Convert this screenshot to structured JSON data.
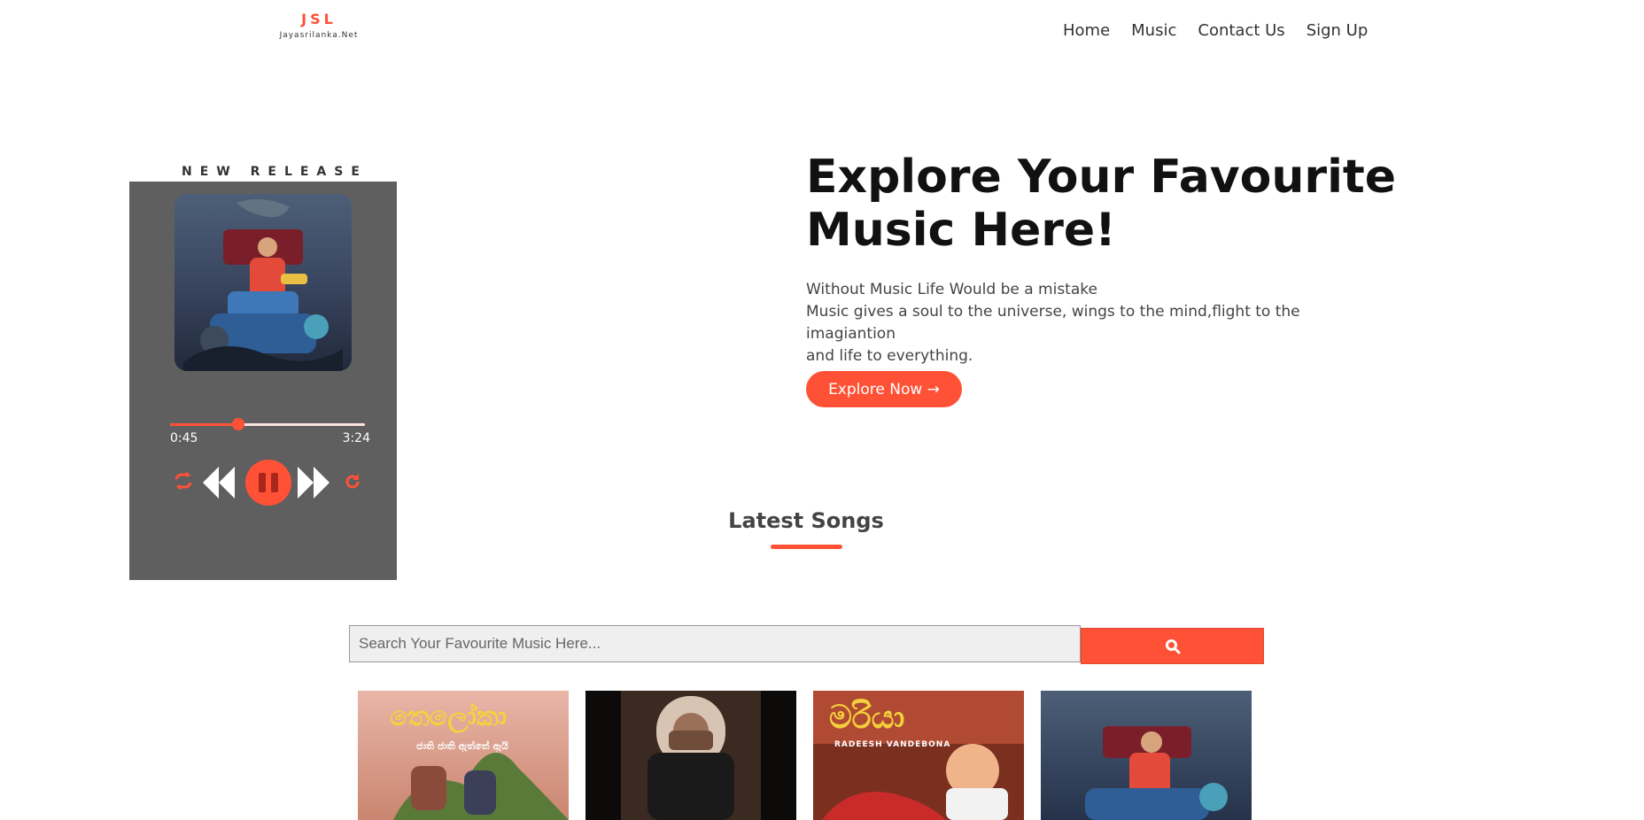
{
  "header": {
    "logo_title": "JSL",
    "logo_subtitle": "Jayasrilanka.Net",
    "nav": [
      "Home",
      "Music",
      "Contact Us",
      "Sign Up"
    ]
  },
  "player": {
    "heading": "NEW RELEASE",
    "current_time": "0:45",
    "duration": "3:24",
    "progress_fraction": 0.35,
    "buttons": [
      "repeat-icon",
      "previous-icon",
      "pause-icon",
      "next-icon",
      "reload-icon"
    ]
  },
  "hero": {
    "title_line1": "Explore Your Favourite",
    "title_line2": "Music Here!",
    "text_line1": "Without Music Life Would be a mistake",
    "text_line2": "Music gives a soul to the universe, wings to the mind,flight to the imagiantion",
    "text_line3": "and life to everything.",
    "button_label": "Explore Now →"
  },
  "latest": {
    "title": "Latest Songs"
  },
  "search": {
    "placeholder": "Search Your Favourite Music Here..."
  },
  "songs": [
    {
      "title": "තෙලෝකා",
      "subtitle": "ජාති ජාති ඇත්තේ ඇයි"
    },
    {
      "title": "",
      "subtitle": ""
    },
    {
      "title": "මරියා",
      "subtitle": "RADEESH VANDEBONA"
    },
    {
      "title": "",
      "subtitle": ""
    }
  ],
  "colors": {
    "accent": "#ff5136",
    "player_bg": "#5f5f5f"
  }
}
